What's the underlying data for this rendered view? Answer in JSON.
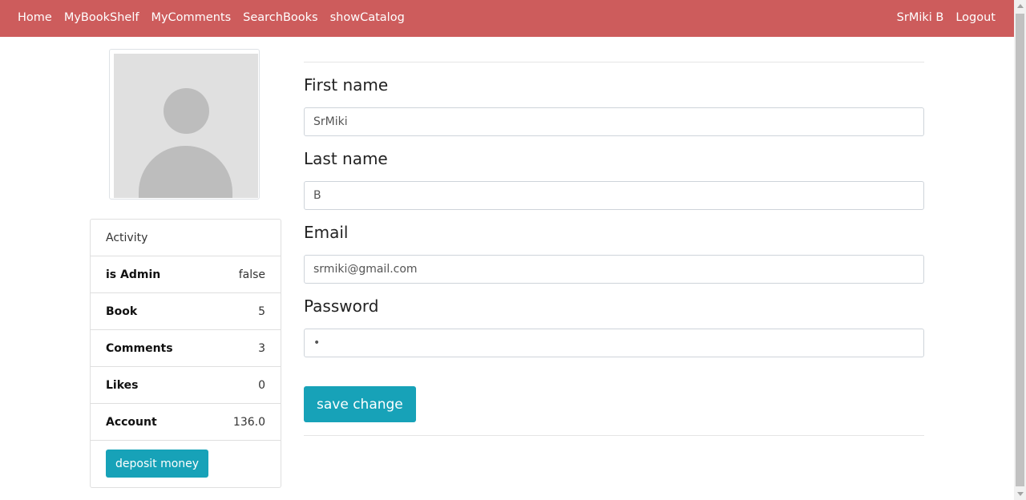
{
  "nav": {
    "left_links": [
      "Home",
      "MyBookShelf",
      "MyComments",
      "SearchBooks",
      "showCatalog"
    ],
    "user_name": "SrMiki B",
    "logout_label": "Logout",
    "bar_color": "#cd5c5c"
  },
  "profile": {
    "avatar_icon": "user-silhouette-icon"
  },
  "activity": {
    "title": "Activity",
    "rows": [
      {
        "label": "is Admin",
        "value": "false"
      },
      {
        "label": "Book",
        "value": "5"
      },
      {
        "label": "Comments",
        "value": "3"
      },
      {
        "label": "Likes",
        "value": "0"
      },
      {
        "label": "Account",
        "value": "136.0"
      }
    ],
    "deposit_label": "deposit money"
  },
  "form": {
    "first_name_label": "First name",
    "first_name_value": "SrMiki",
    "last_name_label": "Last name",
    "last_name_value": "B",
    "email_label": "Email",
    "email_value": "srmiki@gmail.com",
    "password_label": "Password",
    "password_value": "•",
    "save_label": "save change",
    "accent_color": "#17a2b8"
  }
}
